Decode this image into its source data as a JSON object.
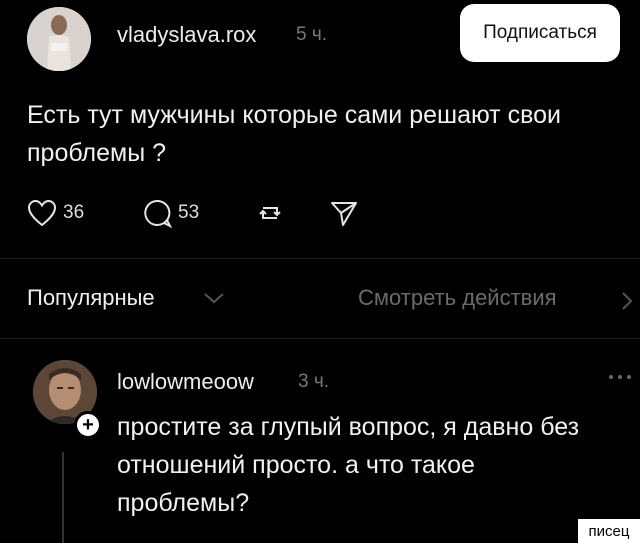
{
  "post": {
    "username": "vladyslava.rox",
    "time": "5 ч.",
    "follow_label": "Подписаться",
    "text": "Есть тут мужчины которые сами решают свои проблемы ?",
    "likes": "36",
    "comments": "53"
  },
  "replies_bar": {
    "sort_label": "Популярные",
    "activity_label": "Смотреть действия"
  },
  "reply": {
    "username": "lowlowmeoow",
    "time": "3 ч.",
    "text_lines": [
      "простите за глупый вопрос, я давно без",
      "отношений просто. а что такое",
      "проблемы?"
    ]
  },
  "watermark": "писец",
  "colors": {
    "background": "#000000",
    "muted": "#777777",
    "button_bg": "#ffffff"
  }
}
